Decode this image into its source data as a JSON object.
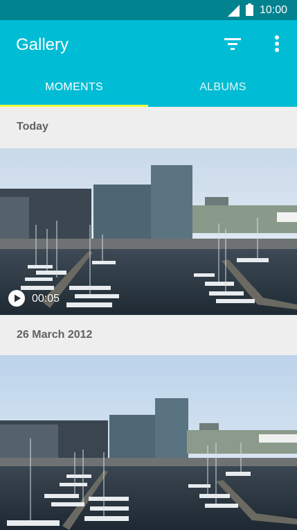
{
  "status_bar": {
    "time": "10:00"
  },
  "app_bar": {
    "title": "Gallery"
  },
  "tabs": [
    {
      "label": "MOMENTS",
      "selected": true
    },
    {
      "label": "ALBUMS",
      "selected": false
    }
  ],
  "sections": [
    {
      "header": "Today",
      "item": {
        "type": "video",
        "duration": "00:05"
      }
    },
    {
      "header": "26 March 2012",
      "item": {
        "type": "photo"
      }
    }
  ],
  "colors": {
    "status_bar": "#00838f",
    "app_bar": "#00bcd4",
    "tab_indicator": "#eeff41"
  }
}
